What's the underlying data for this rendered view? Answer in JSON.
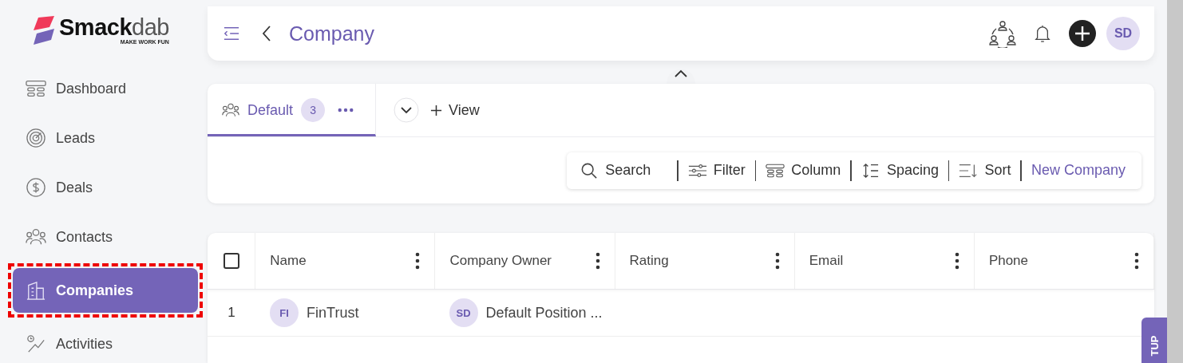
{
  "brand": {
    "main": "Smack",
    "tail": "dab",
    "tagline": "MAKE WORK FUN"
  },
  "sidebar": {
    "items": [
      {
        "label": "Dashboard",
        "selected": false
      },
      {
        "label": "Leads",
        "selected": false
      },
      {
        "label": "Deals",
        "selected": false
      },
      {
        "label": "Contacts",
        "selected": false
      },
      {
        "label": "Companies",
        "selected": true
      },
      {
        "label": "Activities",
        "selected": false
      }
    ]
  },
  "header": {
    "title": "Company",
    "avatar": "SD"
  },
  "views": [
    {
      "label": "Default",
      "count": "3",
      "selected": true
    }
  ],
  "add_view": "View",
  "toolbar": {
    "search": "Search",
    "actions": [
      "Filter",
      "Column",
      "Spacing",
      "Sort"
    ],
    "primary": "New Company"
  },
  "table": {
    "select_all_checked": false,
    "columns": [
      "Name",
      "Company Owner",
      "Rating",
      "Email",
      "Phone"
    ],
    "rows": [
      {
        "number": "1",
        "name_initials": "FI",
        "name": "FinTrust",
        "owner_initials": "SD",
        "owner": "Default Position ..."
      }
    ]
  },
  "setup_tab": "TUP"
}
